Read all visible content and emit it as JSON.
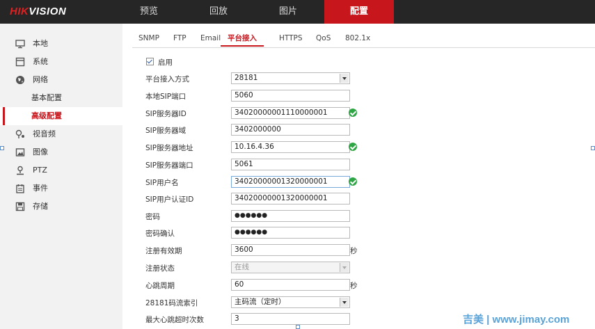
{
  "brand": {
    "logo_hik": "HIK",
    "logo_vision": "VISION"
  },
  "nav": {
    "preview": "预览",
    "playback": "回放",
    "picture": "图片",
    "config": "配置"
  },
  "sidebar": {
    "local": "本地",
    "system": "系统",
    "network": "网络",
    "basic": "基本配置",
    "advanced": "高级配置",
    "video_audio": "视音频",
    "image": "图像",
    "ptz": "PTZ",
    "event": "事件",
    "storage": "存储"
  },
  "tabs": {
    "snmp": "SNMP",
    "ftp": "FTP",
    "email": "Email",
    "platform": "平台接入",
    "https": "HTTPS",
    "qos": "QoS",
    "dot1x": "802.1x"
  },
  "form": {
    "enable_label": "启用",
    "access_mode_label": "平台接入方式",
    "access_mode_value": "28181",
    "local_sip_port_label": "本地SIP端口",
    "local_sip_port_value": "5060",
    "sip_server_id_label": "SIP服务器ID",
    "sip_server_id_value": "34020000001110000001",
    "sip_server_domain_label": "SIP服务器域",
    "sip_server_domain_value": "3402000000",
    "sip_server_addr_label": "SIP服务器地址",
    "sip_server_addr_value": "10.16.4.36",
    "sip_server_port_label": "SIP服务器端口",
    "sip_server_port_value": "5061",
    "sip_username_label": "SIP用户名",
    "sip_username_value": "34020000001320000001",
    "sip_auth_id_label": "SIP用户认证ID",
    "sip_auth_id_value": "34020000001320000001",
    "password_label": "密码",
    "password_value": "●●●●●●",
    "password_confirm_label": "密码确认",
    "password_confirm_value": "●●●●●●",
    "reg_validity_label": "注册有效期",
    "reg_validity_value": "3600",
    "reg_validity_unit": "秒",
    "reg_status_label": "注册状态",
    "reg_status_value": "在线",
    "heartbeat_label": "心跳周期",
    "heartbeat_value": "60",
    "heartbeat_unit": "秒",
    "stream_index_label": "28181码流索引",
    "stream_index_value": "主码流（定时）",
    "max_timeout_label": "最大心跳超时次数",
    "max_timeout_value": "3"
  },
  "watermark": "吉美 | www.jimay.com",
  "colors": {
    "accent": "#c8161d",
    "topbar": "#262626",
    "ok": "#2ea644"
  }
}
